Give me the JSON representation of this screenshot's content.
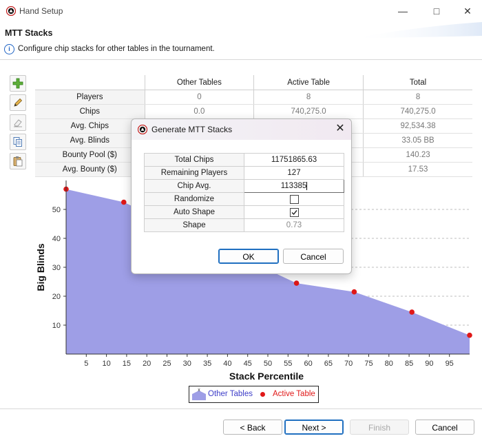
{
  "window": {
    "title": "Hand Setup",
    "icons": {
      "app": "poker-chip-icon",
      "minimize": "minimize-icon",
      "maximize": "maximize-icon",
      "close": "close-icon"
    }
  },
  "header": {
    "title": "MTT Stacks",
    "description": "Configure chip stacks for other tables in the tournament."
  },
  "toolbar": {
    "icons": [
      "add-icon",
      "edit-icon",
      "eraser-icon",
      "copy-icon",
      "paste-icon"
    ]
  },
  "stats_table": {
    "columns": [
      "",
      "Other Tables",
      "Active Table",
      "Total"
    ],
    "rows": [
      {
        "label": "Players",
        "other": "0",
        "active": "8",
        "total": "8"
      },
      {
        "label": "Chips",
        "other": "0.0",
        "active": "740,275.0",
        "total": "740,275.0"
      },
      {
        "label": "Avg. Chips",
        "other": "",
        "active": "",
        "total": "92,534.38"
      },
      {
        "label": "Avg. Blinds",
        "other": "",
        "active": "",
        "total": "33.05 BB"
      },
      {
        "label": "Bounty Pool ($)",
        "other": "",
        "active": "",
        "total": "140.23"
      },
      {
        "label": "Avg. Bounty ($)",
        "other": "",
        "active": "",
        "total": "17.53"
      }
    ]
  },
  "chart_data": {
    "type": "area",
    "xlabel": "Stack Percentile",
    "ylabel": "Big Blinds",
    "xlim": [
      0,
      100
    ],
    "ylim": [
      0,
      60
    ],
    "x_ticks": [
      5,
      10,
      15,
      20,
      25,
      30,
      35,
      40,
      45,
      50,
      55,
      60,
      65,
      70,
      75,
      80,
      85,
      90,
      95
    ],
    "y_ticks": [
      10,
      20,
      30,
      40,
      50
    ],
    "grid": "horizontal-dashed",
    "legend": "bottom-center",
    "series": [
      {
        "name": "Other Tables",
        "kind": "area",
        "color": "#9e9ee6",
        "x": [
          0,
          14.3,
          57.1,
          71.4,
          85.7,
          100
        ],
        "y": [
          57,
          52.5,
          24.5,
          21.5,
          14.5,
          6.5
        ]
      },
      {
        "name": "Active Table",
        "kind": "scatter",
        "color": "#e01818",
        "x": [
          0,
          14.3,
          57.1,
          71.4,
          85.7,
          100
        ],
        "y": [
          57,
          52.5,
          24.5,
          21.5,
          14.5,
          6.5
        ]
      }
    ]
  },
  "footer": {
    "back": "< Back",
    "next": "Next >",
    "finish": "Finish",
    "cancel": "Cancel"
  },
  "dialog": {
    "title": "Generate MTT Stacks",
    "fields": {
      "total_chips": {
        "label": "Total Chips",
        "value": "11751865.63"
      },
      "remaining_players": {
        "label": "Remaining Players",
        "value": "127"
      },
      "chip_avg": {
        "label": "Chip Avg.",
        "value": "113385"
      },
      "randomize": {
        "label": "Randomize",
        "checked": false
      },
      "auto_shape": {
        "label": "Auto Shape",
        "checked": true
      },
      "shape": {
        "label": "Shape",
        "value": "0.73"
      }
    },
    "ok": "OK",
    "cancel": "Cancel"
  }
}
